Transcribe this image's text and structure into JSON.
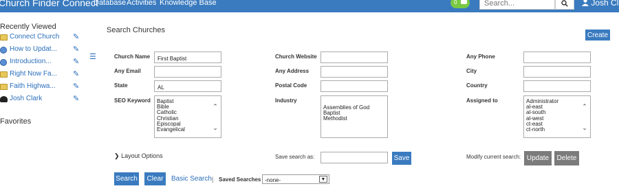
{
  "app": {
    "brand": "Church Finder Connect",
    "nav": [
      "Database",
      "Activities",
      "Knowledge Base"
    ],
    "notification_count": "0",
    "search_placeholder": "Search...",
    "user_name": "Josh Clark",
    "accent_color": "#3a7bbf"
  },
  "sidebar": {
    "recent_title": "Recently Viewed",
    "items": [
      {
        "label": "Connect Church",
        "icon": "folder-icon"
      },
      {
        "label": "How to Updat...",
        "icon": "globe-icon"
      },
      {
        "label": "Introduction...",
        "icon": "globe-icon"
      },
      {
        "label": "Right Now Fa...",
        "icon": "folder-icon"
      },
      {
        "label": "Faith Highwa...",
        "icon": "folder-icon"
      },
      {
        "label": "Josh Clark",
        "icon": "people-icon"
      }
    ],
    "favorites_title": "Favorites"
  },
  "main": {
    "title": "Search Churches",
    "create_label": "Create",
    "fields": {
      "church_name": {
        "label": "Church Name",
        "value": "First Baptist"
      },
      "church_website": {
        "label": "Church Website",
        "value": ""
      },
      "any_phone": {
        "label": "Any Phone",
        "value": ""
      },
      "any_email": {
        "label": "Any Email",
        "value": ""
      },
      "any_address": {
        "label": "Any Address",
        "value": ""
      },
      "city": {
        "label": "City",
        "value": ""
      },
      "state": {
        "label": "State",
        "value": "AL"
      },
      "postal_code": {
        "label": "Postal Code",
        "value": ""
      },
      "country": {
        "label": "Country",
        "value": ""
      }
    },
    "seo_keyword": {
      "label": "SEO Keyword",
      "options": [
        "Baptist",
        "Bible",
        "Catholic",
        "Christian",
        "Episcopal",
        "Evangelical"
      ]
    },
    "industry": {
      "label": "Industry",
      "options": [
        "Assemblies of God",
        "Baptist",
        "Methodist"
      ]
    },
    "assigned_to": {
      "label": "Assigned to",
      "options": [
        "Administrator",
        "al-east",
        "al-south",
        "al-west",
        "ct-east",
        "ct-north"
      ]
    },
    "layout_options": "Layout Options",
    "save_search_label": "Save search as:",
    "save_label": "Save",
    "modify_label": "Modify current search:",
    "update_label": "Update",
    "delete_label": "Delete",
    "search_label": "Search",
    "clear_label": "Clear",
    "basic_search": "Basic Search",
    "separator": "|",
    "saved_searches_label": "Saved Searches",
    "saved_searches_value": "-none-"
  }
}
